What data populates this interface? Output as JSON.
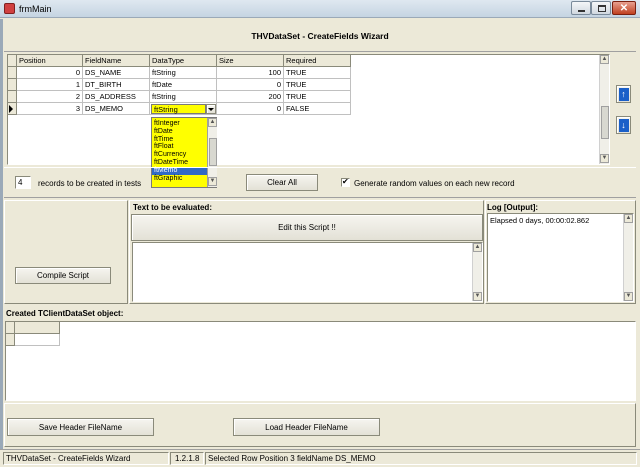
{
  "window": {
    "title": "frmMain"
  },
  "wizard": {
    "title": "THVDataSet - CreateFields Wizard"
  },
  "grid": {
    "columns": [
      "Position",
      "FieldName",
      "DataType",
      "Size",
      "Required"
    ],
    "rows": [
      {
        "position": "0",
        "field": "DS_NAME",
        "type": "ftString",
        "size": "100",
        "required": "TRUE"
      },
      {
        "position": "1",
        "field": "DT_BIRTH",
        "type": "ftDate",
        "size": "0",
        "required": "TRUE"
      },
      {
        "position": "2",
        "field": "DS_ADDRESS",
        "type": "ftString",
        "size": "200",
        "required": "TRUE"
      },
      {
        "position": "3",
        "field": "DS_MEMO",
        "type": "ftString",
        "size": "0",
        "required": "FALSE"
      }
    ],
    "dropdown_options": [
      "ftInteger",
      "ftDate",
      "ftTime",
      "ftFloat",
      "ftCurrency",
      "ftDateTime",
      "ftMemo",
      "ftGraphic"
    ],
    "dropdown_selected": "ftMemo"
  },
  "records": {
    "value": "4",
    "label": "records to be created in tests"
  },
  "buttons": {
    "clear_all": "Clear All",
    "compile": "Compile Script",
    "edit_script": "Edit this Script !!",
    "save_header": "Save Header FileName",
    "load_header": "Load Header FileName"
  },
  "random_values": {
    "label": "Generate random values on each new record",
    "checked": true
  },
  "script": {
    "label": "Text to be evaluated:"
  },
  "log": {
    "label": "Log [Output]:",
    "text": "Elapsed 0 days, 00:00:02.862"
  },
  "created": {
    "label": "Created TClientDataSet object:"
  },
  "status": {
    "app": "THVDataSet - CreateFields Wizard",
    "version": "1.2.1.8",
    "message": "Selected Row Position 3 fieldName DS_MEMO"
  },
  "colors": {
    "dropdown_bg": "#ffff00",
    "selection": "#316ac5",
    "window_bg": "#ece9d8"
  },
  "icons": [
    "app-icon",
    "minimize-icon",
    "maximize-icon",
    "close-icon",
    "arrow-up-icon",
    "arrow-down-icon",
    "row-indicator-icon",
    "dropdown-arrow-icon",
    "checkbox-check-icon"
  ]
}
